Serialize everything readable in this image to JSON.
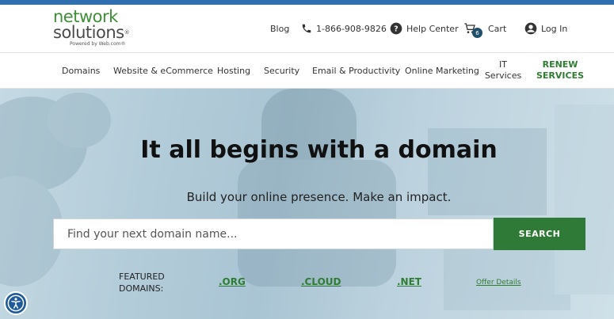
{
  "logo": {
    "line1": "network",
    "line2": "solutions",
    "registered": "®",
    "powered_by": "Powered by Web.com®"
  },
  "utility": {
    "blog": "Blog",
    "phone_icon": "phone-icon",
    "phone": "1-866-908-9826",
    "help_icon": "question-circle-icon",
    "help": "Help Center",
    "cart_icon": "shopping-cart-icon",
    "cart_count": "6",
    "cart": "Cart",
    "login_icon": "user-circle-icon",
    "login": "Log In"
  },
  "nav": {
    "items": [
      "Domains",
      "Website & eCommerce",
      "Hosting",
      "Security",
      "Email & Productivity",
      "Online Marketing"
    ],
    "it_line1": "IT",
    "it_line2": "Services",
    "renew_line1": "RENEW",
    "renew_line2": "SERVICES"
  },
  "hero": {
    "title": "It all begins with a domain",
    "subtitle": "Build your online presence. Make an impact.",
    "search_placeholder": "Find your next domain name...",
    "search_button": "SEARCH",
    "featured_line1": "FEATURED",
    "featured_line2": "DOMAINS:",
    "featured": [
      ".ORG",
      ".CLOUD",
      ".NET"
    ],
    "offer_details": "Offer Details"
  },
  "accessibility_icon": "accessibility-icon",
  "colors": {
    "topbar": "#2f6fb0",
    "brand_green": "#3f8f38",
    "button_green": "#2f7a36",
    "link_green": "#2e7d32",
    "badge": "#1f4f6b",
    "accessibility": "#1f5a9c"
  }
}
